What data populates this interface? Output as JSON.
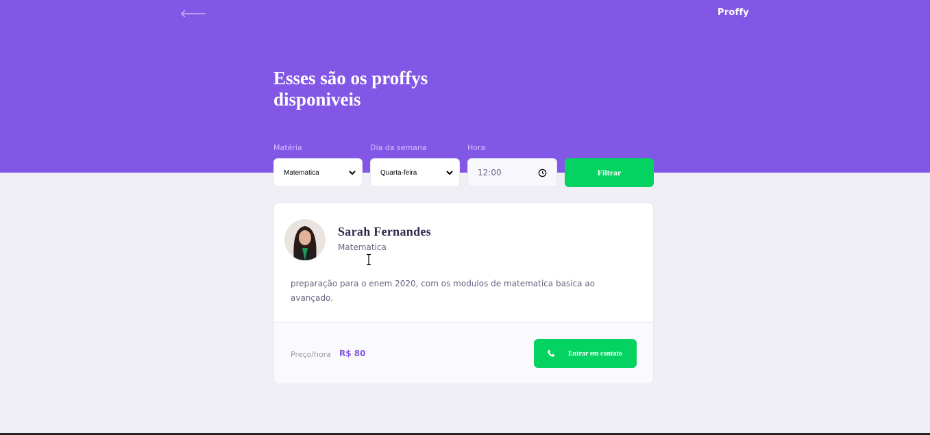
{
  "header": {
    "logo": "Proffy",
    "back_icon": "arrow-left-icon",
    "title": "Esses são os proffys disponiveis"
  },
  "filters": {
    "subject": {
      "label": "Matéria",
      "value": "Matematica"
    },
    "weekday": {
      "label": "Dia da semana",
      "value": "Quarta-feira"
    },
    "time": {
      "label": "Hora",
      "value": "12:00"
    },
    "submit_label": "Filtrar"
  },
  "teacher": {
    "name": "Sarah Fernandes",
    "subject": "Matematica",
    "bio": "preparação para o enem 2020, com os modulos de matematica basica ao avançado.",
    "price_label": "Preço/hora",
    "price_value": "R$ 80",
    "contact_label": "Entrar em contato",
    "contact_icon": "whatsapp-icon"
  },
  "colors": {
    "primary": "#8257e5",
    "secondary": "#04d361",
    "background": "#f0eff5"
  }
}
